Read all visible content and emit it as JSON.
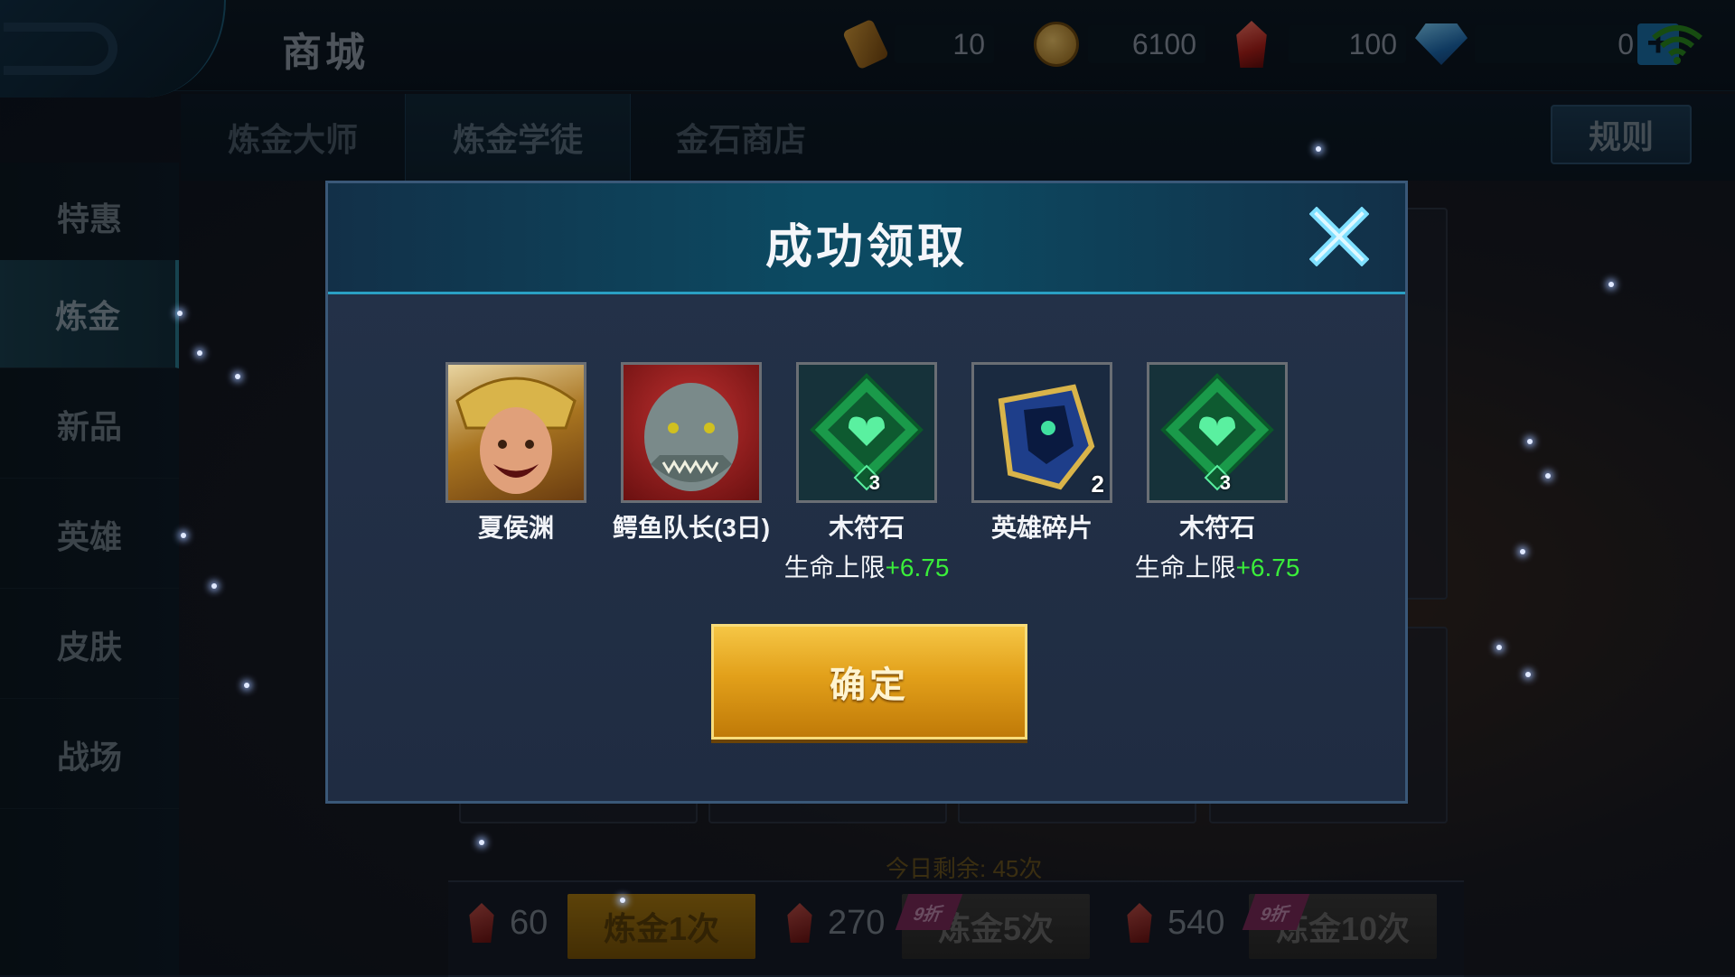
{
  "header": {
    "title": "商城",
    "resources": [
      {
        "icon": "voucher-icon",
        "value": "10"
      },
      {
        "icon": "gold-coin-icon",
        "value": "6100"
      },
      {
        "icon": "crystal-icon",
        "value": "100"
      },
      {
        "icon": "diamond-icon",
        "value": "0"
      }
    ]
  },
  "tabs": [
    "炼金大师",
    "炼金学徒",
    "金石商店"
  ],
  "active_tab": "炼金学徒",
  "rules_label": "规则",
  "sidebar": {
    "items": [
      {
        "label": "特惠"
      },
      {
        "label": "炼金"
      },
      {
        "label": "新品"
      },
      {
        "label": "英雄"
      },
      {
        "label": "皮肤"
      },
      {
        "label": "战场"
      }
    ],
    "active": "炼金"
  },
  "bottom": {
    "remaining": "今日剩余: 45次",
    "options": [
      {
        "cost": "60",
        "label": "炼金1次",
        "badge": ""
      },
      {
        "cost": "270",
        "label": "炼金5次",
        "badge": "9折"
      },
      {
        "cost": "540",
        "label": "炼金10次",
        "badge": "9折"
      }
    ]
  },
  "modal": {
    "title": "成功领取",
    "confirm_label": "确定",
    "rewards": [
      {
        "name": "夏侯渊",
        "icon": "hero-portrait-icon",
        "qty": "",
        "attr": "",
        "bonus": ""
      },
      {
        "name": "鳄鱼队长(3日)",
        "icon": "crocodile-captain-portrait-icon",
        "qty": "",
        "attr": "",
        "bonus": ""
      },
      {
        "name": "木符石",
        "icon": "wood-rune-icon",
        "qty": "3",
        "attr": "生命上限",
        "bonus": "+6.75"
      },
      {
        "name": "英雄碎片",
        "icon": "hero-fragment-icon",
        "qty": "2",
        "attr": "",
        "bonus": ""
      },
      {
        "name": "木符石",
        "icon": "wood-rune-icon",
        "qty": "3",
        "attr": "生命上限",
        "bonus": "+6.75"
      }
    ]
  },
  "colors": {
    "bonus_green": "#3aee3a",
    "confirm_gold": "#e2a01a",
    "accent_cyan": "#2aa0c4"
  }
}
